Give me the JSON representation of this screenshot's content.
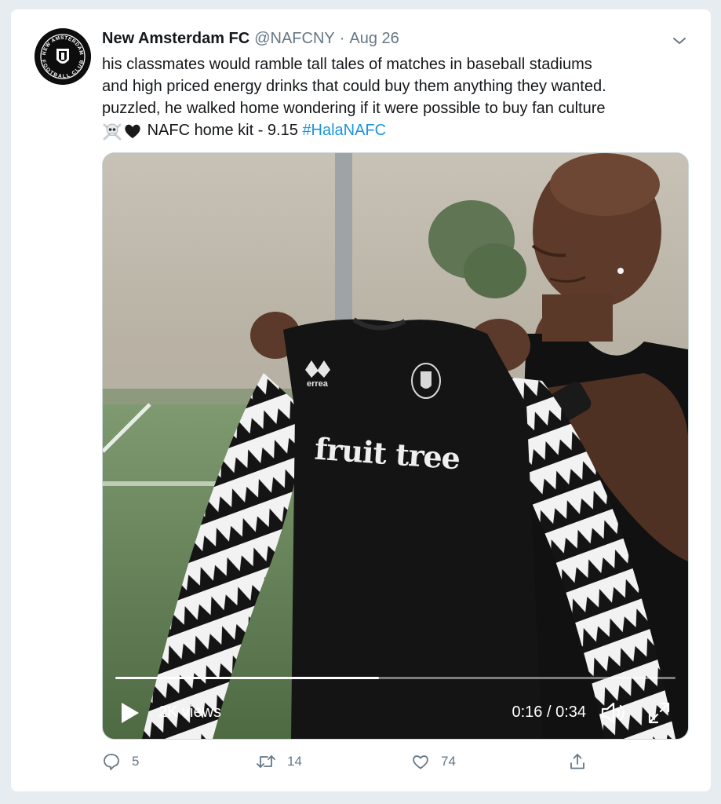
{
  "tweet": {
    "author_name": "New Amsterdam FC",
    "handle": "@NAFCNY",
    "separator": "·",
    "date": "Aug 26",
    "text_lines": [
      "his classmates would ramble tall tales of matches in baseball stadiums",
      "and high priced energy drinks that could buy them anything they wanted.",
      "puzzled, he walked home wondering if it were possible to buy fan culture"
    ],
    "last_line_text": "NAFC home kit - 9.15",
    "hashtag": "#HalaNAFC",
    "emojis": [
      "skull-and-crossbones",
      "black-heart"
    ]
  },
  "avatar": {
    "logo_text_top": "NEW AMSTERDAM",
    "logo_text_bottom": "FOOTBALL CLUB"
  },
  "video": {
    "shirt_sponsor": "fruit tree",
    "shirt_brand": "errea",
    "views_label": "2K views",
    "time_label": "0:16 / 0:34",
    "progress_fraction": 0.47
  },
  "actions": {
    "reply_count": "5",
    "retweet_count": "14",
    "like_count": "74"
  },
  "colors": {
    "hashtag": "#1b95e0",
    "muted": "#657786",
    "page_bg": "#e6ecf0"
  }
}
